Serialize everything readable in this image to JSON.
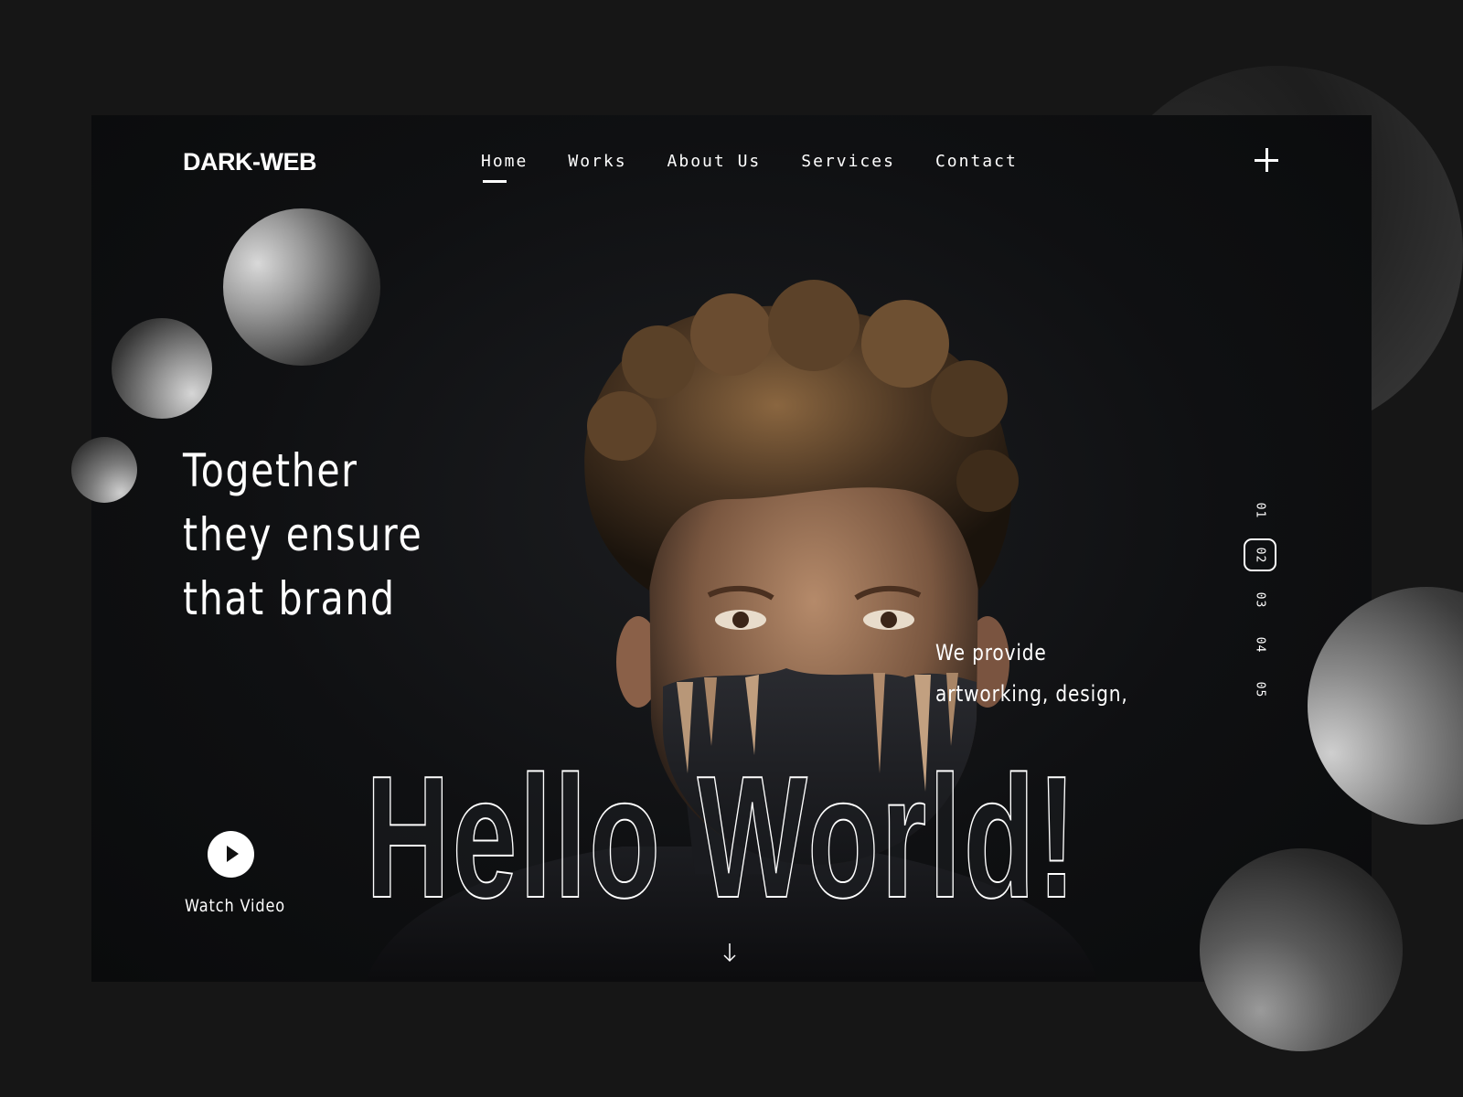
{
  "brand": {
    "logo": "DARK-WEB"
  },
  "nav": {
    "items": [
      {
        "label": "Home",
        "active": true
      },
      {
        "label": "Works",
        "active": false
      },
      {
        "label": "About Us",
        "active": false
      },
      {
        "label": "Services",
        "active": false
      },
      {
        "label": "Contact",
        "active": false
      }
    ]
  },
  "hero": {
    "headline_lines": [
      "Together",
      "they ensure",
      "that brand"
    ],
    "subtext_lines": [
      "We provide",
      "artworking, design,"
    ],
    "big_title": "Hello World!",
    "watch_video_label": "Watch Video"
  },
  "pager": {
    "items": [
      "01",
      "02",
      "03",
      "04",
      "05"
    ],
    "active_index": 1
  },
  "icons": {
    "menu": "plus-icon",
    "play": "play-icon",
    "scroll": "arrow-down-icon"
  },
  "colors": {
    "background": "#161616",
    "hero_background": "#0f1012",
    "text": "#ffffff"
  }
}
